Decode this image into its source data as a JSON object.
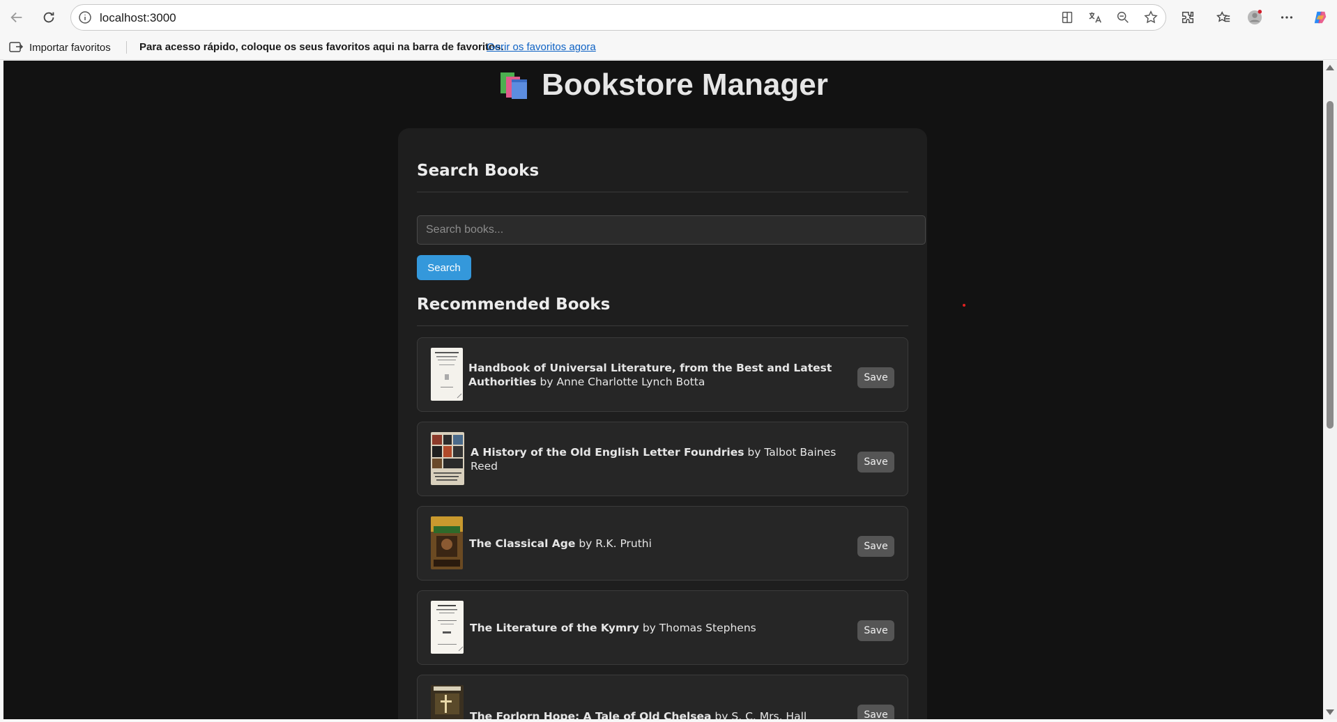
{
  "browser": {
    "url": "localhost:3000",
    "favorites_import_label": "Importar favoritos",
    "favorites_message": "Para acesso rápido, coloque os seus favoritos aqui na barra de favoritos.",
    "favorites_link": "Gerir os favoritos agora"
  },
  "app": {
    "title": "Bookstore Manager",
    "search_section_title": "Search Books",
    "search_placeholder": "Search books...",
    "search_button_label": "Search",
    "recommended_section_title": "Recommended Books",
    "by_word": "by",
    "save_label": "Save",
    "books": [
      {
        "title": "Handbook of Universal Literature, from the Best and Latest Authorities",
        "author": "Anne Charlotte Lynch Botta"
      },
      {
        "title": "A History of the Old English Letter Foundries",
        "author": "Talbot Baines Reed"
      },
      {
        "title": "The Classical Age",
        "author": "R.K. Pruthi"
      },
      {
        "title": "The Literature of the Kymry",
        "author": "Thomas Stephens"
      },
      {
        "title": "The Forlorn Hope: A Tale of Old Chelsea",
        "author": "S. C. Mrs. Hall"
      }
    ]
  }
}
